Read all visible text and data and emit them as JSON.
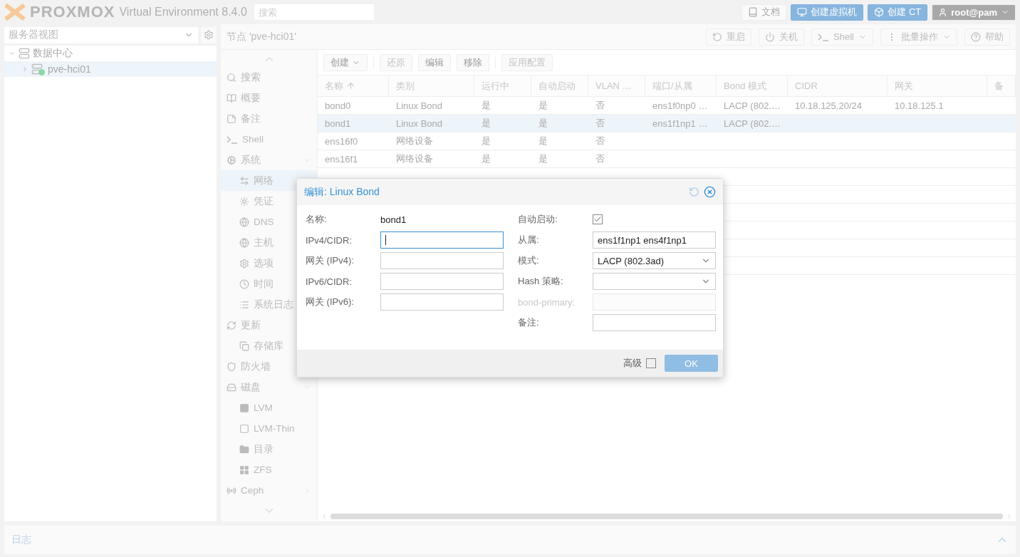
{
  "topbar": {
    "logo": "PROXMOX",
    "product": "Virtual Environment 8.4.0",
    "search": {
      "placeholder": "搜索"
    },
    "buttons": [
      {
        "label": "文档",
        "kind": "docs"
      },
      {
        "label": "创建虚拟机",
        "kind": "vm"
      },
      {
        "label": "创建 CT",
        "kind": "ct"
      }
    ],
    "user": "root@pam"
  },
  "sidebar": {
    "view": "服务器视图",
    "tree": [
      {
        "label": "数据中心",
        "expanded": true,
        "selected": false,
        "children": [
          {
            "label": "pve-hci01",
            "selected": true
          }
        ]
      }
    ]
  },
  "node": {
    "title": "节点 'pve-hci01'",
    "buttons": [
      {
        "label": "重启",
        "kind": "reload"
      },
      {
        "label": "关机",
        "kind": "power"
      },
      {
        "label": "Shell",
        "kind": "shell"
      },
      {
        "label": "批量操作",
        "kind": "bulk"
      },
      {
        "label": "帮助",
        "kind": "help"
      }
    ]
  },
  "nav": [
    {
      "label": "搜索",
      "kind": "search",
      "selected": false
    },
    {
      "label": "概要",
      "kind": "book",
      "selected": false
    },
    {
      "label": "备注",
      "kind": "note",
      "selected": false
    },
    {
      "label": "Shell",
      "kind": "shell",
      "selected": false
    },
    {
      "label": "系统",
      "kind": "cogs",
      "selected": false,
      "expanded": true,
      "children": [
        {
          "label": "网络",
          "kind": "network",
          "selected": true
        },
        {
          "label": "凭证",
          "kind": "cert",
          "selected": false
        },
        {
          "label": "DNS",
          "kind": "globe",
          "selected": false
        },
        {
          "label": "主机",
          "kind": "globe",
          "selected": false
        },
        {
          "label": "选项",
          "kind": "gear",
          "selected": false
        },
        {
          "label": "时间",
          "kind": "clock",
          "selected": false
        },
        {
          "label": "系统日志",
          "kind": "list",
          "selected": false
        }
      ]
    },
    {
      "label": "更新",
      "kind": "refresh",
      "selected": false,
      "children": [
        {
          "label": "存储库",
          "kind": "copy",
          "selected": false
        }
      ]
    },
    {
      "label": "防火墙",
      "kind": "shield",
      "selected": false
    },
    {
      "label": "磁盘",
      "kind": "disk",
      "selected": false,
      "expanded": true,
      "children": [
        {
          "label": "LVM",
          "kind": "square",
          "selected": false
        },
        {
          "label": "LVM-Thin",
          "kind": "squareo",
          "selected": false
        },
        {
          "label": "目录",
          "kind": "folder",
          "selected": false
        },
        {
          "label": "ZFS",
          "kind": "grid",
          "selected": false
        }
      ]
    },
    {
      "label": "Ceph",
      "kind": "ceph",
      "selected": false,
      "expanded": false
    }
  ],
  "toolbar": [
    {
      "label": "创建",
      "kind": "menu",
      "disabled": false
    },
    {
      "label": "还原",
      "kind": "plain",
      "disabled": true
    },
    {
      "label": "编辑",
      "kind": "plain",
      "disabled": false
    },
    {
      "label": "移除",
      "kind": "plain",
      "disabled": false
    },
    {
      "label": "应用配置",
      "kind": "plain",
      "disabled": true
    }
  ],
  "table": {
    "columns": [
      {
        "label": "名称",
        "sorted": true
      },
      {
        "label": "类别"
      },
      {
        "label": "运行中"
      },
      {
        "label": "自动启动"
      },
      {
        "label": "VLAN …"
      },
      {
        "label": "端口/从属"
      },
      {
        "label": "Bond 模式"
      },
      {
        "label": "CIDR"
      },
      {
        "label": "网关"
      },
      {
        "label": "备"
      }
    ],
    "rows": [
      {
        "selected": false,
        "cells": [
          "bond0",
          "Linux Bond",
          "是",
          "是",
          "否",
          "ens1f0np0 …",
          "LACP (802.…",
          "10.18.125.20/24",
          "10.18.125.1"
        ]
      },
      {
        "selected": true,
        "cells": [
          "bond1",
          "Linux Bond",
          "是",
          "是",
          "否",
          "ens1f1np1 …",
          "LACP (802.…"
        ]
      },
      {
        "selected": false,
        "cells": [
          "ens16f0",
          "网络设备",
          "是",
          "是",
          "否"
        ]
      },
      {
        "selected": false,
        "cells": [
          "ens16f1",
          "网络设备",
          "是",
          "是",
          "否"
        ]
      }
    ]
  },
  "dialog": {
    "title": "编辑: Linux Bond",
    "left": [
      {
        "label": "名称:",
        "kind": "display",
        "value": "bond1"
      },
      {
        "label": "IPv4/CIDR:",
        "kind": "text",
        "focused": true
      },
      {
        "label": "网关 (IPv4):",
        "kind": "text",
        "focused": false
      },
      {
        "label": "IPv6/CIDR:",
        "kind": "text",
        "focused": false
      },
      {
        "label": "网关 (IPv6):",
        "kind": "text",
        "focused": false
      }
    ],
    "right": [
      {
        "label": "自动启动:",
        "kind": "checkbox",
        "checked": true
      },
      {
        "label": "从属:",
        "kind": "text",
        "value": "ens1f1np1 ens4f1np1",
        "focused": false
      },
      {
        "label": "模式:",
        "kind": "select",
        "value": "LACP (802.3ad)"
      },
      {
        "label": "Hash 策略:",
        "kind": "select"
      },
      {
        "label": "bond-primary:",
        "kind": "text",
        "disabled": true,
        "focused": false
      },
      {
        "label": "备注:",
        "kind": "text",
        "focused": false
      }
    ],
    "advanced": {
      "label": "高级",
      "checked": false
    },
    "ok": "OK"
  },
  "log": {
    "title": "日志",
    "expanded": false
  }
}
